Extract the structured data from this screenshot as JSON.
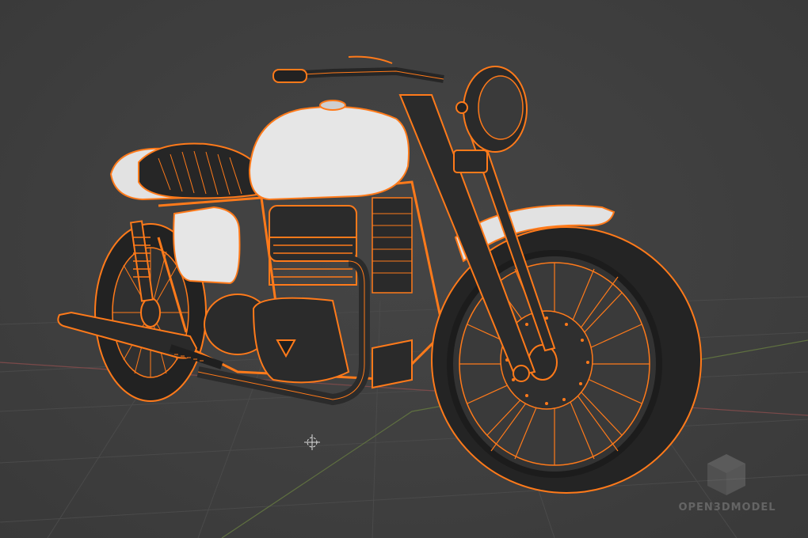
{
  "viewport": {
    "mode": "3d-viewport-object-selected",
    "selection_outline_color": "#ff7a1a",
    "background_color": "#3d3d3d",
    "grid_line_color": "#4a4a4a",
    "x_axis_color": "#7b4a4a",
    "y_axis_color": "#5f7040"
  },
  "model": {
    "subject": "cafe-racer-motorcycle",
    "body_color": "#2b2b2b",
    "panel_color": "#e6e6e6",
    "spoke_color": "#ff7a1a"
  },
  "watermark": {
    "text": "OPEN3DMODEL",
    "icon": "cube-icon"
  }
}
